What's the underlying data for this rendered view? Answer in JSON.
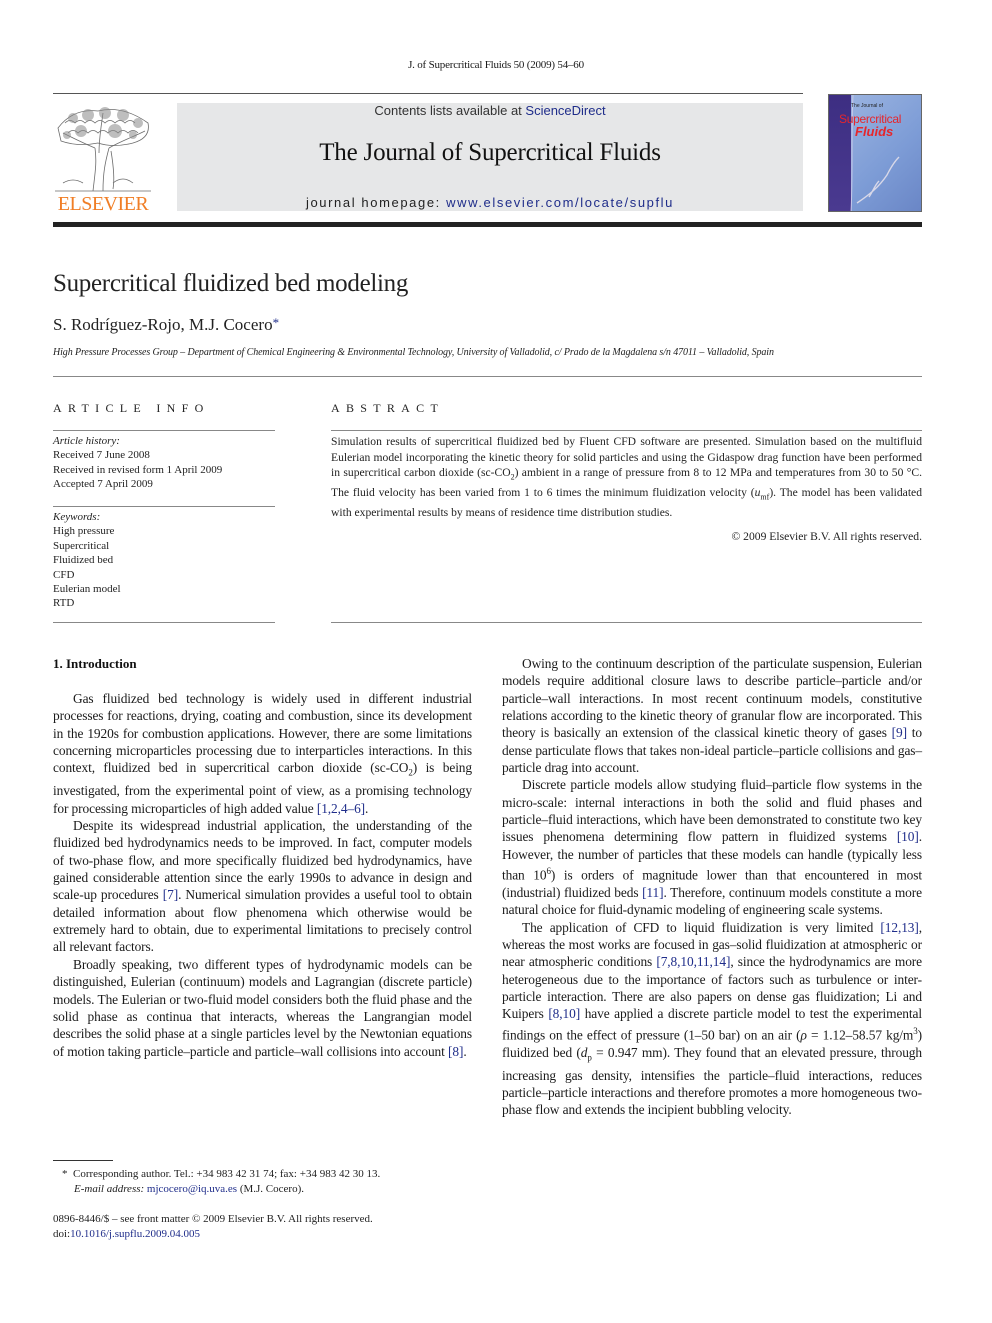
{
  "header": {
    "running_head": "J. of Supercritical Fluids 50 (2009) 54–60",
    "publisher_wordmark": "ELSEVIER",
    "contents_prefix": "Contents lists available at ",
    "contents_link": "ScienceDirect",
    "journal_title": "The Journal of Supercritical Fluids",
    "homepage_prefix": "journal homepage: ",
    "homepage_link": "www.elsevier.com/locate/supflu",
    "cover": {
      "small_text": "The Journal of",
      "title_line1": "Supercritical",
      "title_line2": "Fluids"
    },
    "colors": {
      "elsevier_orange": "#f07e26",
      "link_blue": "#1f2d8a",
      "masthead_gray": "#e6e7e8"
    }
  },
  "article": {
    "title": "Supercritical fluidized bed modeling",
    "authors": "S. Rodríguez-Rojo, M.J. Cocero",
    "corresponding_mark": "*",
    "affiliation": "High Pressure Processes Group – Department of Chemical Engineering & Environmental Technology, University of Valladolid, c/ Prado de la Magdalena s/n 47011 – Valladolid, Spain"
  },
  "article_info": {
    "heading": "ARTICLE INFO",
    "history_label": "Article history:",
    "history": [
      "Received 7 June 2008",
      "Received in revised form 1 April 2009",
      "Accepted 7 April 2009"
    ],
    "keywords_label": "Keywords:",
    "keywords": [
      "High pressure",
      "Supercritical",
      "Fluidized bed",
      "CFD",
      "Eulerian model",
      "RTD"
    ]
  },
  "abstract": {
    "heading": "ABSTRACT",
    "part1": "Simulation results of supercritical fluidized bed by Fluent CFD software are presented. Simulation based on the multifluid Eulerian model incorporating the kinetic theory for solid particles and using the Gidaspow drag function have been performed in supercritical carbon dioxide (sc-CO",
    "sub1": "2",
    "part2": ") ambient in a range of pressure from 8 to 12 MPa and temperatures from 30 to 50 °C. The fluid velocity has been varied from 1 to 6 times the minimum fluidization velocity (",
    "umf_u": "u",
    "umf_sub": "mf",
    "part3": "). The model has been validated with experimental results by means of residence time distribution studies.",
    "copyright": "© 2009 Elsevier B.V. All rights reserved."
  },
  "introduction": {
    "heading": "1.  Introduction",
    "left": {
      "p1_a": "Gas fluidized bed technology is widely used in different industrial processes for reactions, drying, coating and combustion, since its development in the 1920s for combustion applications. However, there are some limitations concerning microparticles processing due to interparticles interactions. In this context, fluidized bed in supercritical carbon dioxide (sc-CO",
      "p1_sub": "2",
      "p1_b": ") is being investigated, from the experimental point of view, as a promising technology for processing microparticles of high added value ",
      "p1_ref": "[1,2,4–6]",
      "p1_end": ".",
      "p2_a": "Despite its widespread industrial application, the understanding of the fluidized bed hydrodynamics needs to be improved. In fact, computer models of two-phase flow, and more specifically fluidized bed hydrodynamics, have gained considerable attention since the early 1990s to advance in design and scale-up procedures ",
      "p2_ref": "[7]",
      "p2_b": ". Numerical simulation provides a useful tool to obtain detailed information about flow phenomena which otherwise would be extremely hard to obtain, due to experimental limitations to precisely control all relevant factors.",
      "p3_a": "Broadly speaking, two different types of hydrodynamic models can be distinguished, Eulerian (continuum) models and Lagrangian (discrete particle) models. The Eulerian or two-fluid model considers both the fluid phase and the solid phase as continua that interacts, whereas the Langrangian model describes the solid phase at a single particles level by the Newtonian equations of motion taking particle–particle and particle–wall collisions into account ",
      "p3_ref": "[8]",
      "p3_end": "."
    },
    "right": {
      "p1_a": "Owing to the continuum description of the particulate suspension, Eulerian models require additional closure laws to describe particle–particle and/or particle–wall interactions. In most recent continuum models, constitutive relations according to the kinetic theory of granular flow are incorporated. This theory is basically an extension of the classical kinetic theory of gases ",
      "p1_ref": "[9]",
      "p1_b": " to dense particulate flows that takes non-ideal particle–particle collisions and gas–particle drag into account.",
      "p2_a": "Discrete particle models allow studying fluid–particle flow systems in the micro-scale: internal interactions in both the solid and fluid phases and particle–fluid interactions, which have been demonstrated to constitute two key issues phenomena determining flow pattern in fluidized systems ",
      "p2_ref1": "[10]",
      "p2_b": ". However, the number of particles that these models can handle (typically less than 10",
      "p2_sup": "6",
      "p2_c": ") is orders of magnitude lower than that encountered in most (industrial) fluidized beds ",
      "p2_ref2": "[11]",
      "p2_d": ". Therefore, continuum models constitute a more natural choice for fluid-dynamic modeling of engineering scale systems.",
      "p3_a": "The application of CFD to liquid fluidization is very limited ",
      "p3_ref1": "[12,13]",
      "p3_b": ", whereas the most works are focused in gas–solid fluidization at atmospheric or near atmospheric conditions ",
      "p3_ref2": "[7,8,10,11,14]",
      "p3_c": ", since the hydrodynamics are more heterogeneous due to the importance of factors such as turbulence or inter-particle interaction. There are also papers on dense gas fluidization; Li and Kuipers ",
      "p3_ref3": "[8,10]",
      "p3_d": " have applied a discrete particle model to test the experimental findings on the effect of pressure (1–50 bar) on an air (",
      "p3_rho": "ρ",
      "p3_e": " = 1.12–58.57 kg/m",
      "p3_sup": "3",
      "p3_f": ") fluidized bed (",
      "p3_d_sym": "d",
      "p3_d_sub": "p",
      "p3_g": " = 0.947 mm). They found that an elevated pressure, through increasing gas density, intensifies the particle–fluid interactions, reduces particle–particle interactions and therefore promotes a more homogeneous two-phase flow and extends the incipient bubbling velocity."
    }
  },
  "footnote": {
    "mark": "*",
    "text": "Corresponding author. Tel.: +34 983 42 31 74; fax: +34 983 42 30 13.",
    "email_label": "E-mail address: ",
    "email": "mjcocero@iq.uva.es",
    "email_suffix": " (M.J. Cocero)."
  },
  "front_matter": {
    "issn_line": "0896-8446/$ – see front matter © 2009 Elsevier B.V. All rights reserved.",
    "doi_prefix": "doi:",
    "doi": "10.1016/j.supflu.2009.04.005"
  }
}
